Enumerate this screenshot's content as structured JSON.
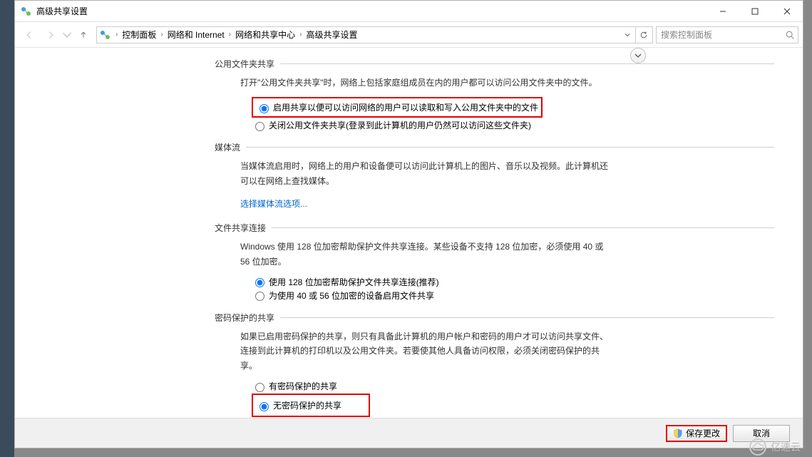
{
  "window": {
    "title": "高级共享设置",
    "min_tip": "—",
    "max_tip": "☐",
    "close_tip": "✕"
  },
  "breadcrumbs": {
    "items": [
      "控制面板",
      "网络和 Internet",
      "网络和共享中心",
      "高级共享设置"
    ]
  },
  "search": {
    "placeholder": "搜索控制面板"
  },
  "sections": {
    "public_folder": {
      "title": "公用文件夹共享",
      "desc": "打开\"公用文件夹共享\"时，网络上包括家庭组成员在内的用户都可以访问公用文件夹中的文件。",
      "opt_on": "启用共享以便可以访问网络的用户可以读取和写入公用文件夹中的文件",
      "opt_off": "关闭公用文件夹共享(登录到此计算机的用户仍然可以访问这些文件夹)"
    },
    "media": {
      "title": "媒体流",
      "desc": "当媒体流启用时，网络上的用户和设备便可以访问此计算机上的图片、音乐以及视频。此计算机还可以在网络上查找媒体。",
      "link": "选择媒体流选项..."
    },
    "conn": {
      "title": "文件共享连接",
      "desc": "Windows 使用 128 位加密帮助保护文件共享连接。某些设备不支持 128 位加密，必须使用 40 或 56 位加密。",
      "opt_128": "使用 128 位加密帮助保护文件共享连接(推荐)",
      "opt_40": "为使用 40 或 56 位加密的设备启用文件共享"
    },
    "password": {
      "title": "密码保护的共享",
      "desc": "如果已启用密码保护的共享，则只有具备此计算机的用户帐户和密码的用户才可以访问共享文件、连接到此计算机的打印机以及公用文件夹。若要使其他人具备访问权限，必须关闭密码保护的共享。",
      "opt_on": "有密码保护的共享",
      "opt_off": "无密码保护的共享"
    }
  },
  "footer": {
    "save": "保存更改",
    "cancel": "取消"
  },
  "watermark": {
    "text": "亿速云"
  }
}
